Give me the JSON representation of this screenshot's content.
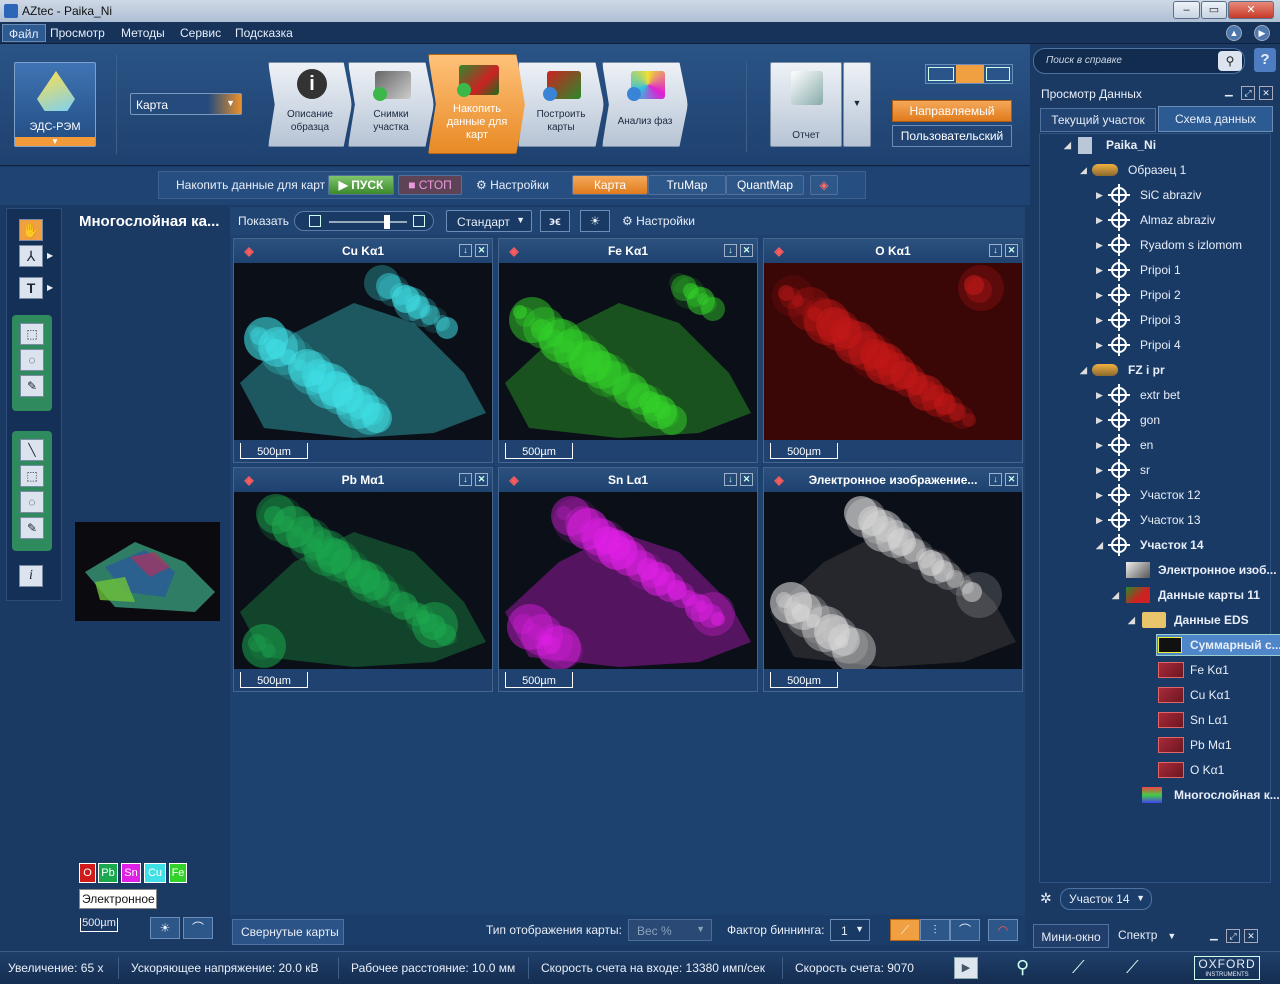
{
  "window": {
    "title": "AZtec - Paika_Ni",
    "minimize": "–",
    "maximize": "▭",
    "close": "✕"
  },
  "menu": [
    "Файл",
    "Просмотр",
    "Методы",
    "Сервис",
    "Подсказка"
  ],
  "ribbon": {
    "mode_label": "ЭДС-РЭМ",
    "method_select": "Карта",
    "steps": [
      {
        "label": "Описание образца"
      },
      {
        "label": "Снимки участка"
      },
      {
        "label": "Накопить данные для карт"
      },
      {
        "label": "Построить карты"
      },
      {
        "label": "Анализ фаз"
      }
    ],
    "report_label": "Отчет",
    "guided_label": "Направляемый",
    "custom_label": "Пользовательский"
  },
  "toolrow": {
    "acquire_label": "Накопить данные для карт",
    "start": "ПУСК",
    "stop": "СТОП",
    "settings": "Настройки",
    "tabs": [
      "Карта",
      "TruMap",
      "QuantMap"
    ]
  },
  "maprow": {
    "show_label": "Показать",
    "standard": "Стандарт",
    "settings": "Настройки",
    "show_level": 0.7
  },
  "left": {
    "title": "Многослойная ка...",
    "legend": [
      "O",
      "Pb",
      "Sn",
      "Cu",
      "Fe"
    ],
    "electron_label": "Электронное",
    "scale": "500µm"
  },
  "maps": [
    {
      "title": "Cu Kα1",
      "scale": "500µm",
      "color": "#3fe0e6"
    },
    {
      "title": "Fe Kα1",
      "scale": "500µm",
      "color": "#33d22a"
    },
    {
      "title": "O Kα1",
      "scale": "500µm",
      "color": "#d11a1a"
    },
    {
      "title": "Pb Mα1",
      "scale": "500µm",
      "color": "#1ca84e"
    },
    {
      "title": "Sn Lα1",
      "scale": "500µm",
      "color": "#e020e6"
    },
    {
      "title": "Электронное изображение...",
      "scale": "500µm",
      "color": "#d8d8d8"
    }
  ],
  "bottomrow": {
    "collapsed": "Свернутые карты",
    "map_type_label": "Тип отображения карты:",
    "map_type_value": "Вес %",
    "binning_label": "Фактор биннинга:",
    "binning_value": "1"
  },
  "right": {
    "search_placeholder": "Поиск в справке",
    "panel_title": "Просмотр Данных",
    "tabs": [
      "Текущий участок",
      "Схема данных"
    ],
    "tree": [
      {
        "label": "Paika_Ni"
      },
      {
        "label": "Образец 1"
      },
      {
        "label": "SiC abraziv"
      },
      {
        "label": "Almaz abraziv"
      },
      {
        "label": "Ryadom s izlomom"
      },
      {
        "label": "Pripoi 1"
      },
      {
        "label": "Pripoi 2"
      },
      {
        "label": "Pripoi 3"
      },
      {
        "label": "Pripoi 4"
      },
      {
        "label": "FZ i pr"
      },
      {
        "label": "extr bet"
      },
      {
        "label": "gon"
      },
      {
        "label": "en"
      },
      {
        "label": "sr"
      },
      {
        "label": "Участок 12"
      },
      {
        "label": "Участок 13"
      },
      {
        "label": "Участок 14"
      },
      {
        "label": "Электронное изоб..."
      },
      {
        "label": "Данные карты 11"
      },
      {
        "label": "Данные EDS"
      },
      {
        "label": "Суммарный с..."
      },
      {
        "label": "Fe Kα1"
      },
      {
        "label": "Cu Kα1"
      },
      {
        "label": "Sn Lα1"
      },
      {
        "label": "Pb Mα1"
      },
      {
        "label": "O Kα1"
      },
      {
        "label": "Многослойная к..."
      }
    ],
    "site_select": "Участок 14",
    "mini_tab": "Мини-окно",
    "spectrum_tab": "Спектр"
  },
  "status": {
    "mag": "Увеличение: 65 x",
    "hv": "Ускоряющее напряжение: 20.0 кВ",
    "wd": "Рабочее расстояние: 10.0 мм",
    "icr": "Скорость счета на входе: 13380 имп/сек",
    "ocr": "Скорость счета: 9070",
    "brand": "OXFORD",
    "brand_sub": "INSTRUMENTS"
  }
}
